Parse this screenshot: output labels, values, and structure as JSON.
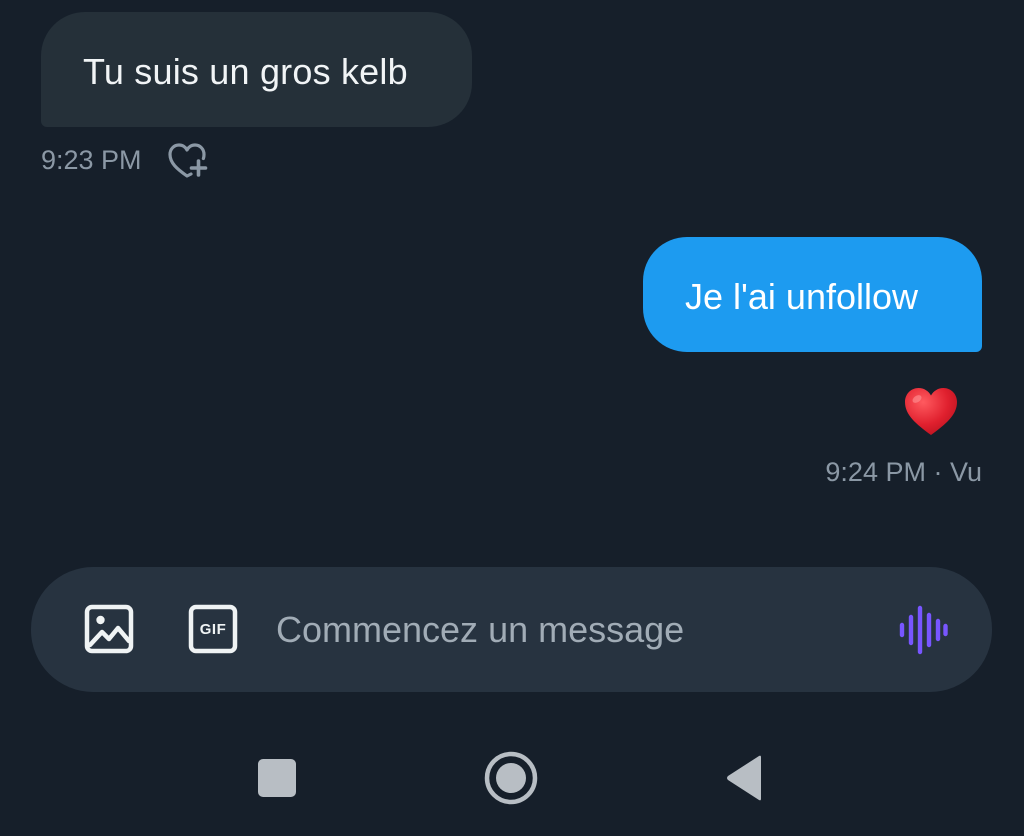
{
  "messages": {
    "received": {
      "text": "Tu suis un gros kelb",
      "time": "9:23 PM",
      "react_icon": "heart-plus-icon"
    },
    "sent": {
      "text": "Je l'ai unfollow",
      "reaction": "❤️",
      "time": "9:24 PM",
      "separator": " · ",
      "status": "Vu"
    }
  },
  "composer": {
    "placeholder": "Commencez un message",
    "value": "",
    "image_icon": "image-icon",
    "gif_label": "GIF",
    "voice_icon": "voice-message-icon"
  },
  "navbar": {
    "recents_icon": "square-recents-icon",
    "home_icon": "circle-home-icon",
    "back_icon": "triangle-back-icon"
  },
  "colors": {
    "background": "#161f2a",
    "received_bubble": "#253039",
    "sent_bubble": "#1d9bf0",
    "composer": "#273340",
    "meta_text": "#8b98a5",
    "voice_accent": "#7856ff",
    "reaction_heart": "#e0202e"
  }
}
